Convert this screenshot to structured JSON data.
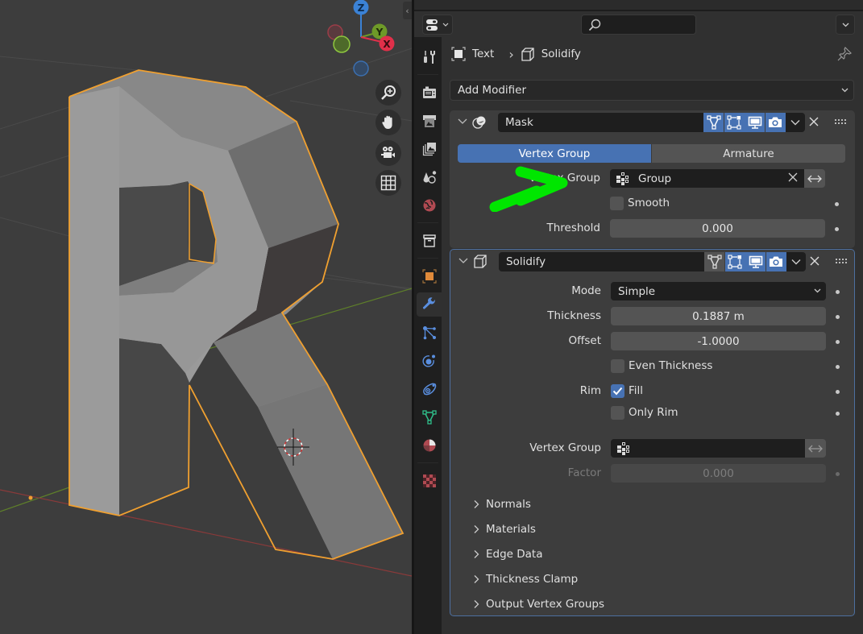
{
  "viewport": {
    "gizmo": {
      "z": "Z",
      "y": "Y",
      "x": "X"
    },
    "nav_buttons": [
      "zoom-icon",
      "hand-pan-icon",
      "camera-view-icon",
      "grid-ortho-icon"
    ],
    "collapse_glyph": "‹"
  },
  "properties": {
    "search": {
      "placeholder": ""
    },
    "tabs": [
      {
        "icon": "tool-icon",
        "active": false
      },
      {
        "icon": "render-icon",
        "active": false
      },
      {
        "icon": "output-icon",
        "active": false
      },
      {
        "icon": "view-layer-icon",
        "active": false
      },
      {
        "icon": "scene-icon",
        "active": false
      },
      {
        "icon": "world-icon",
        "active": false
      },
      {
        "icon": "collection-icon",
        "active": false
      },
      {
        "icon": "object-icon",
        "active": false
      },
      {
        "icon": "modifier-wrench-icon",
        "active": true
      },
      {
        "icon": "particles-icon",
        "active": false
      },
      {
        "icon": "physics-icon",
        "active": false
      },
      {
        "icon": "constraints-icon",
        "active": false
      },
      {
        "icon": "data-icon",
        "active": false
      },
      {
        "icon": "material-icon",
        "active": false
      },
      {
        "icon": "texture-icon",
        "active": false
      }
    ],
    "breadcrumb": {
      "object": "Text",
      "separator": "›",
      "modifier": "Solidify"
    },
    "add_modifier": "Add Modifier",
    "mask": {
      "name": "Mask",
      "mode_tabs": [
        {
          "label": "Vertex Group",
          "active": true
        },
        {
          "label": "Armature",
          "active": false
        }
      ],
      "vertex_group_label": "Vertex Group",
      "vertex_group_value": "Group",
      "smooth_label": "Smooth",
      "smooth_checked": false,
      "threshold_label": "Threshold",
      "threshold_value": "0.000"
    },
    "solidify": {
      "name": "Solidify",
      "mode_label": "Mode",
      "mode_value": "Simple",
      "thickness_label": "Thickness",
      "thickness_value": "0.1887 m",
      "offset_label": "Offset",
      "offset_value": "-1.0000",
      "even_thickness_label": "Even Thickness",
      "even_thickness_checked": false,
      "rim_label": "Rim",
      "fill_label": "Fill",
      "fill_checked": true,
      "only_rim_label": "Only Rim",
      "only_rim_checked": false,
      "vertex_group_label": "Vertex Group",
      "vertex_group_value": "",
      "factor_label": "Factor",
      "factor_value": "0.000",
      "subpanels": [
        "Normals",
        "Materials",
        "Edge Data",
        "Thickness Clamp",
        "Output Vertex Groups"
      ]
    }
  },
  "colors": {
    "accent": "#4772b3",
    "selection_outline": "#f0a030",
    "annotation_arrow": "#00e600",
    "x_axis": "#e0304a",
    "y_axis": "#6e9a28",
    "z_axis": "#3b82d6"
  }
}
